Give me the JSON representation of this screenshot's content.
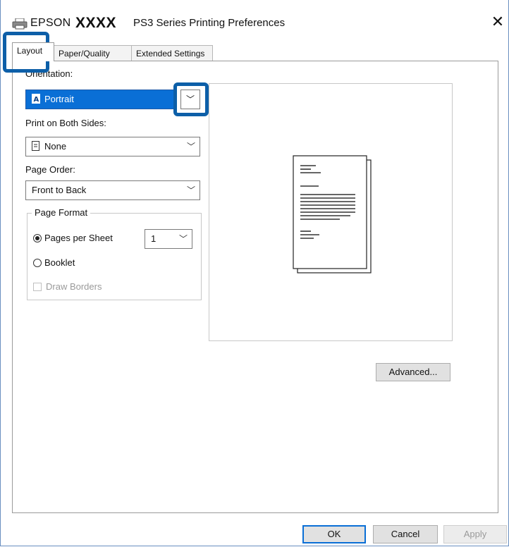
{
  "title": {
    "brand": "EPSON",
    "model": "XXXX",
    "description": "PS3 Series Printing Preferences",
    "close_label": "✕"
  },
  "tabs": [
    {
      "label": "Layout",
      "active": true
    },
    {
      "label": "Paper/Quality",
      "active": false
    },
    {
      "label": "Extended Settings",
      "active": false
    }
  ],
  "orientation": {
    "label": "Orientation:",
    "value": "Portrait"
  },
  "both_sides": {
    "label": "Print on Both Sides:",
    "value": "None"
  },
  "page_order": {
    "label": "Page Order:",
    "value": "Front to Back"
  },
  "page_format": {
    "title": "Page Format",
    "pages_per_sheet_label": "Pages per Sheet",
    "pages_per_sheet_value": "1",
    "booklet_label": "Booklet",
    "draw_borders_label": "Draw Borders",
    "pages_per_sheet_checked": true,
    "booklet_checked": false,
    "draw_borders_checked": false
  },
  "buttons": {
    "advanced": "Advanced...",
    "ok": "OK",
    "cancel": "Cancel",
    "apply": "Apply"
  },
  "icons": {
    "chevron": "chevron-down-icon",
    "printer": "printer-icon",
    "close": "close-icon"
  },
  "colors": {
    "selection": "#0a6fd6",
    "highlight": "#0d5fa8"
  }
}
